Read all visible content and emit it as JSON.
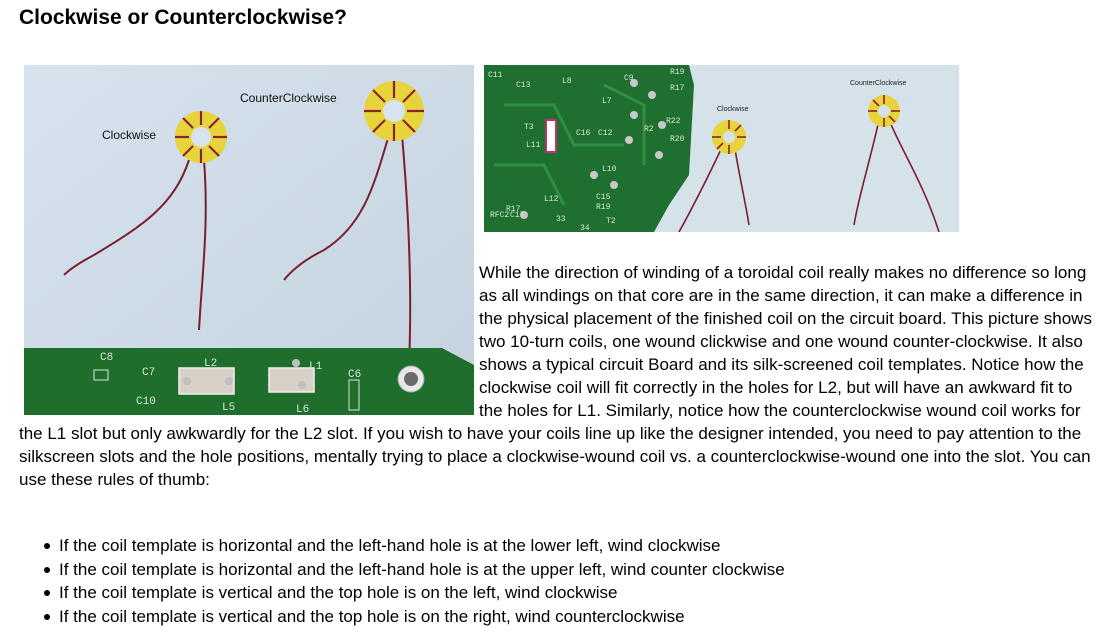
{
  "page": {
    "title": "Clockwise or Counterclockwise?"
  },
  "photo1": {
    "label_clockwise": "Clockwise",
    "label_counterclockwise": "CounterClockwise",
    "silkscreen": [
      "C8",
      "C7",
      "C10",
      "L2",
      "L5",
      "L1",
      "C6",
      "L6"
    ]
  },
  "photo2": {
    "label_clockwise": "Clockwise",
    "label_counterclockwise": "CounterClockwise",
    "silkscreen": [
      "C11",
      "C13",
      "L8",
      "C9",
      "R19",
      "R17",
      "L7",
      "L11",
      "C16",
      "C12",
      "R2",
      "R22",
      "R20",
      "T3",
      "L10",
      "L12",
      "C15",
      "R17",
      "R19",
      "RFC2",
      "C17",
      "33",
      "T2",
      "34"
    ]
  },
  "body_text": "While the direction of winding of a toroidal coil really makes no difference so long as all windings on that core are in the same direction, it can make a difference in the physical placement of the finished coil on the circuit board. This picture shows two 10-turn coils, one wound clickwise and one wound counter-clockwise. It also shows a typical circuit Board and its silk-screened coil templates. Notice how the clockwise coil will fit correctly in the holes for L2, but will have an awkward fit to the holes for L1. Similarly, notice how the counterclockwise wound coil works for the L1 slot but only awkwardly for the L2 slot. If you wish to have your coils line up like the designer intended, you need to pay attention to the silkscreen slots and the hole positions, mentally trying to place a clockwise-wound coil vs. a counterclockwise-wound one into the slot. You can use these rules of thumb:",
  "rules": [
    "If the coil template is horizontal and the left-hand hole is at the lower left, wind clockwise",
    "If the coil template is horizontal and the left-hand hole is at the upper left, wind counter clockwise",
    "If the coil template is vertical and the top hole is on the left, wind clockwise",
    "If the coil template is vertical and the top hole is on the right, wind counterclockwise"
  ],
  "colors": {
    "board_green": "#1f6e2c",
    "toroid_yellow": "#e8d635",
    "wire_copper": "#8a2233"
  }
}
